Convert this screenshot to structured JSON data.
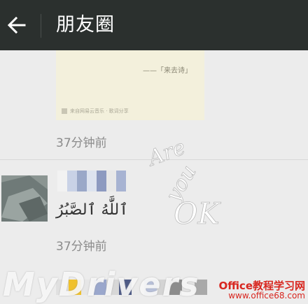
{
  "header": {
    "title": "朋友圈",
    "back_icon": "arrow-left-icon"
  },
  "shared_card": {
    "quote_line": "——「来去诗」",
    "source_text": "来自网易云音乐 · 歌词分享"
  },
  "posts": [
    {
      "time": "37分钟前"
    },
    {
      "time": "37分钟前",
      "text": "ٱللَّٰهُ ٱلصَّبُرُ"
    }
  ],
  "watermarks": {
    "handwriting": "Are you OK !",
    "site_logo": "MyDrivers",
    "office_title": "Office教程学习网",
    "office_url": "www.office68.com"
  },
  "colors": {
    "topbar_bg": "#2b302e",
    "page_bg": "#ececec",
    "time_text": "#8b8b8b",
    "office_red": "#d8261f"
  }
}
